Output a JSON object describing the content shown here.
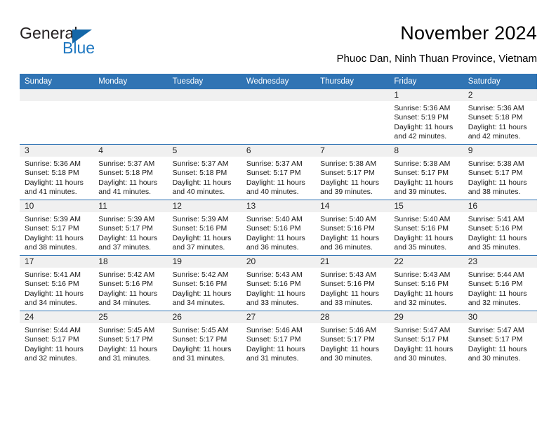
{
  "brand": {
    "name_part1": "General",
    "name_part2": "Blue",
    "triangle_color": "#1467a8",
    "blue_text_color": "#1f78c1"
  },
  "header": {
    "title": "November 2024",
    "subtitle": "Phuoc Dan, Ninh Thuan Province, Vietnam"
  },
  "theme": {
    "header_blue": "#3074b4",
    "daynum_band": "#f0f0f0",
    "cell_background": "#ffffff",
    "row_divider": "#3074b4"
  },
  "calendar": {
    "weekday_headers": [
      "Sunday",
      "Monday",
      "Tuesday",
      "Wednesday",
      "Thursday",
      "Friday",
      "Saturday"
    ],
    "weeks": [
      [
        {
          "day": "",
          "lines": []
        },
        {
          "day": "",
          "lines": []
        },
        {
          "day": "",
          "lines": []
        },
        {
          "day": "",
          "lines": []
        },
        {
          "day": "",
          "lines": []
        },
        {
          "day": "1",
          "lines": [
            "Sunrise: 5:36 AM",
            "Sunset: 5:19 PM",
            "Daylight: 11 hours",
            "and 42 minutes."
          ]
        },
        {
          "day": "2",
          "lines": [
            "Sunrise: 5:36 AM",
            "Sunset: 5:18 PM",
            "Daylight: 11 hours",
            "and 42 minutes."
          ]
        }
      ],
      [
        {
          "day": "3",
          "lines": [
            "Sunrise: 5:36 AM",
            "Sunset: 5:18 PM",
            "Daylight: 11 hours",
            "and 41 minutes."
          ]
        },
        {
          "day": "4",
          "lines": [
            "Sunrise: 5:37 AM",
            "Sunset: 5:18 PM",
            "Daylight: 11 hours",
            "and 41 minutes."
          ]
        },
        {
          "day": "5",
          "lines": [
            "Sunrise: 5:37 AM",
            "Sunset: 5:18 PM",
            "Daylight: 11 hours",
            "and 40 minutes."
          ]
        },
        {
          "day": "6",
          "lines": [
            "Sunrise: 5:37 AM",
            "Sunset: 5:17 PM",
            "Daylight: 11 hours",
            "and 40 minutes."
          ]
        },
        {
          "day": "7",
          "lines": [
            "Sunrise: 5:38 AM",
            "Sunset: 5:17 PM",
            "Daylight: 11 hours",
            "and 39 minutes."
          ]
        },
        {
          "day": "8",
          "lines": [
            "Sunrise: 5:38 AM",
            "Sunset: 5:17 PM",
            "Daylight: 11 hours",
            "and 39 minutes."
          ]
        },
        {
          "day": "9",
          "lines": [
            "Sunrise: 5:38 AM",
            "Sunset: 5:17 PM",
            "Daylight: 11 hours",
            "and 38 minutes."
          ]
        }
      ],
      [
        {
          "day": "10",
          "lines": [
            "Sunrise: 5:39 AM",
            "Sunset: 5:17 PM",
            "Daylight: 11 hours",
            "and 38 minutes."
          ]
        },
        {
          "day": "11",
          "lines": [
            "Sunrise: 5:39 AM",
            "Sunset: 5:17 PM",
            "Daylight: 11 hours",
            "and 37 minutes."
          ]
        },
        {
          "day": "12",
          "lines": [
            "Sunrise: 5:39 AM",
            "Sunset: 5:16 PM",
            "Daylight: 11 hours",
            "and 37 minutes."
          ]
        },
        {
          "day": "13",
          "lines": [
            "Sunrise: 5:40 AM",
            "Sunset: 5:16 PM",
            "Daylight: 11 hours",
            "and 36 minutes."
          ]
        },
        {
          "day": "14",
          "lines": [
            "Sunrise: 5:40 AM",
            "Sunset: 5:16 PM",
            "Daylight: 11 hours",
            "and 36 minutes."
          ]
        },
        {
          "day": "15",
          "lines": [
            "Sunrise: 5:40 AM",
            "Sunset: 5:16 PM",
            "Daylight: 11 hours",
            "and 35 minutes."
          ]
        },
        {
          "day": "16",
          "lines": [
            "Sunrise: 5:41 AM",
            "Sunset: 5:16 PM",
            "Daylight: 11 hours",
            "and 35 minutes."
          ]
        }
      ],
      [
        {
          "day": "17",
          "lines": [
            "Sunrise: 5:41 AM",
            "Sunset: 5:16 PM",
            "Daylight: 11 hours",
            "and 34 minutes."
          ]
        },
        {
          "day": "18",
          "lines": [
            "Sunrise: 5:42 AM",
            "Sunset: 5:16 PM",
            "Daylight: 11 hours",
            "and 34 minutes."
          ]
        },
        {
          "day": "19",
          "lines": [
            "Sunrise: 5:42 AM",
            "Sunset: 5:16 PM",
            "Daylight: 11 hours",
            "and 34 minutes."
          ]
        },
        {
          "day": "20",
          "lines": [
            "Sunrise: 5:43 AM",
            "Sunset: 5:16 PM",
            "Daylight: 11 hours",
            "and 33 minutes."
          ]
        },
        {
          "day": "21",
          "lines": [
            "Sunrise: 5:43 AM",
            "Sunset: 5:16 PM",
            "Daylight: 11 hours",
            "and 33 minutes."
          ]
        },
        {
          "day": "22",
          "lines": [
            "Sunrise: 5:43 AM",
            "Sunset: 5:16 PM",
            "Daylight: 11 hours",
            "and 32 minutes."
          ]
        },
        {
          "day": "23",
          "lines": [
            "Sunrise: 5:44 AM",
            "Sunset: 5:16 PM",
            "Daylight: 11 hours",
            "and 32 minutes."
          ]
        }
      ],
      [
        {
          "day": "24",
          "lines": [
            "Sunrise: 5:44 AM",
            "Sunset: 5:17 PM",
            "Daylight: 11 hours",
            "and 32 minutes."
          ]
        },
        {
          "day": "25",
          "lines": [
            "Sunrise: 5:45 AM",
            "Sunset: 5:17 PM",
            "Daylight: 11 hours",
            "and 31 minutes."
          ]
        },
        {
          "day": "26",
          "lines": [
            "Sunrise: 5:45 AM",
            "Sunset: 5:17 PM",
            "Daylight: 11 hours",
            "and 31 minutes."
          ]
        },
        {
          "day": "27",
          "lines": [
            "Sunrise: 5:46 AM",
            "Sunset: 5:17 PM",
            "Daylight: 11 hours",
            "and 31 minutes."
          ]
        },
        {
          "day": "28",
          "lines": [
            "Sunrise: 5:46 AM",
            "Sunset: 5:17 PM",
            "Daylight: 11 hours",
            "and 30 minutes."
          ]
        },
        {
          "day": "29",
          "lines": [
            "Sunrise: 5:47 AM",
            "Sunset: 5:17 PM",
            "Daylight: 11 hours",
            "and 30 minutes."
          ]
        },
        {
          "day": "30",
          "lines": [
            "Sunrise: 5:47 AM",
            "Sunset: 5:17 PM",
            "Daylight: 11 hours",
            "and 30 minutes."
          ]
        }
      ]
    ]
  }
}
